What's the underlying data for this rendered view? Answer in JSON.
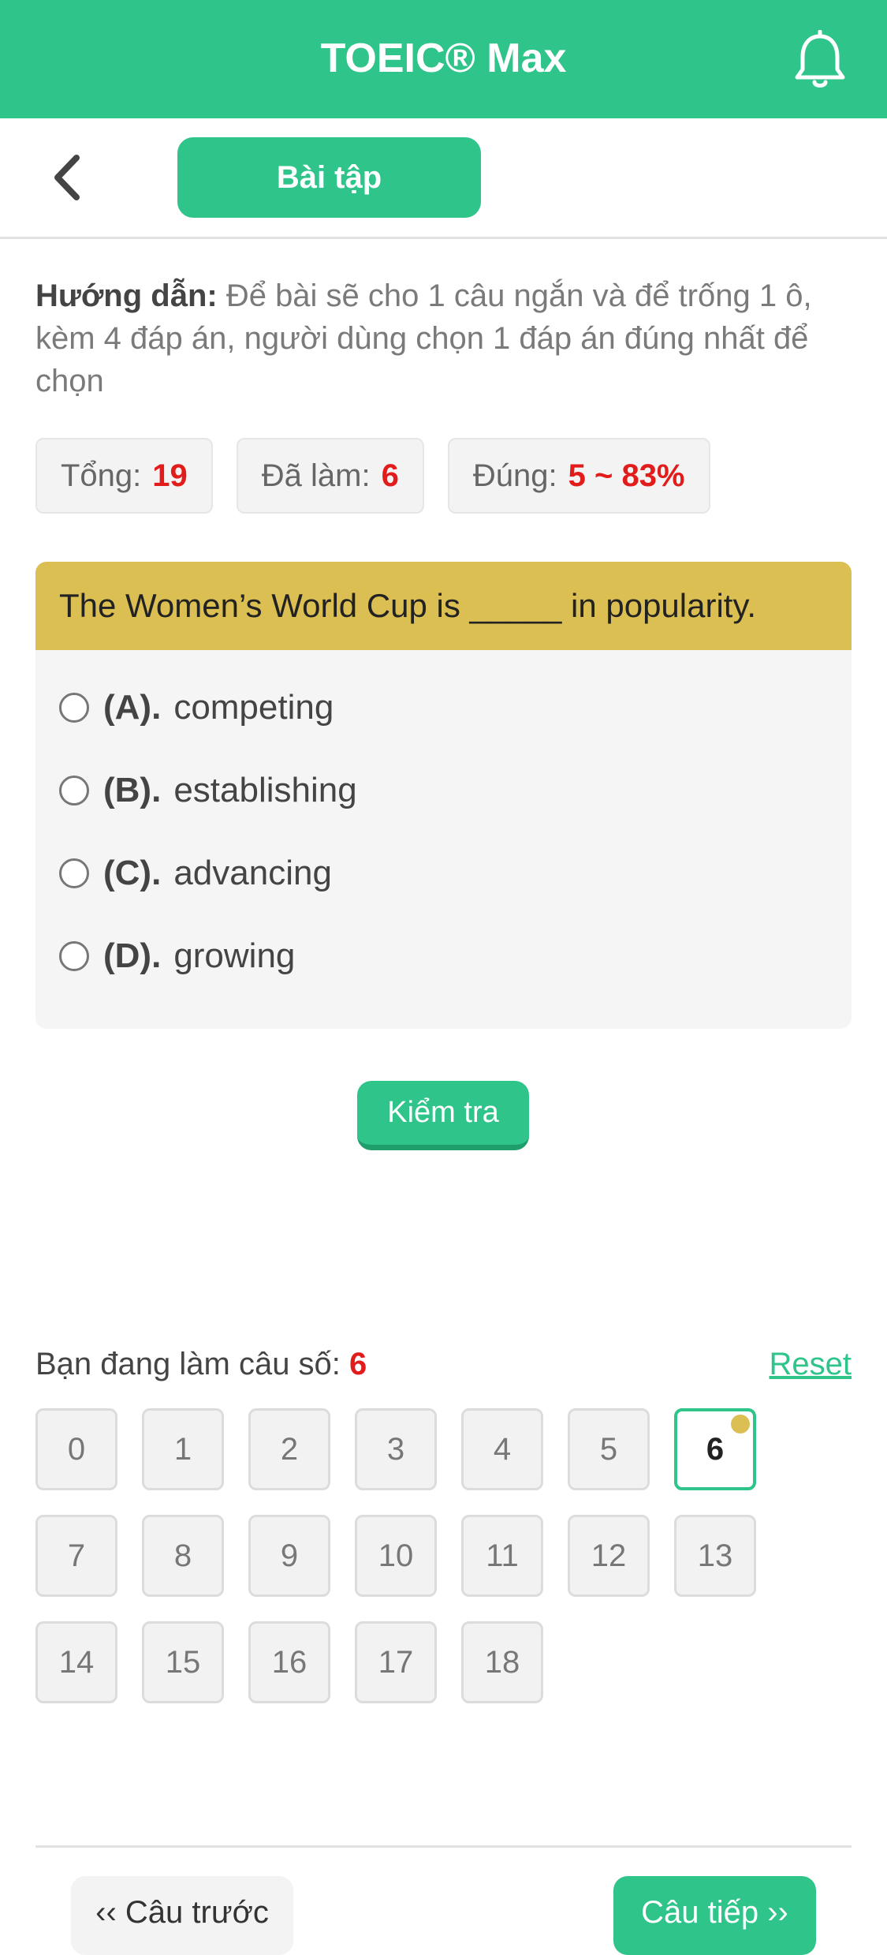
{
  "header": {
    "title": "TOEIC® Max",
    "icon": "bell-icon"
  },
  "subbar": {
    "back_icon": "chevron-left-icon",
    "tab_label": "Bài tập"
  },
  "instruction": {
    "label": "Hướng dẫn:",
    "text": " Để bài sẽ cho 1 câu ngắn và để trống 1 ô, kèm 4 đáp án, người dùng chọn 1 đáp án đúng nhất để chọn"
  },
  "stats": {
    "total_label": "Tổng:",
    "total_value": "19",
    "done_label": "Đã làm:",
    "done_value": "6",
    "correct_label": "Đúng:",
    "correct_value": "5 ~ 83%"
  },
  "question": {
    "text": "The Women’s World Cup is _____ in popularity.",
    "options": [
      {
        "letter": "(A).",
        "text": "competing"
      },
      {
        "letter": "(B).",
        "text": "establishing"
      },
      {
        "letter": "(C).",
        "text": "advancing"
      },
      {
        "letter": "(D).",
        "text": "growing"
      }
    ]
  },
  "check_button": "Kiểm tra",
  "progress": {
    "label": "Bạn đang làm câu số: ",
    "current": "6",
    "reset": "Reset"
  },
  "question_numbers": [
    "0",
    "1",
    "2",
    "3",
    "4",
    "5",
    "6",
    "7",
    "8",
    "9",
    "10",
    "11",
    "12",
    "13",
    "14",
    "15",
    "16",
    "17",
    "18"
  ],
  "active_question": "6",
  "navigation": {
    "prev": "‹‹ Câu trước",
    "next": "Câu tiếp ››"
  },
  "colors": {
    "brand": "#2ec48a",
    "question_bar": "#dcbf52",
    "highlight": "#e21b1b"
  }
}
